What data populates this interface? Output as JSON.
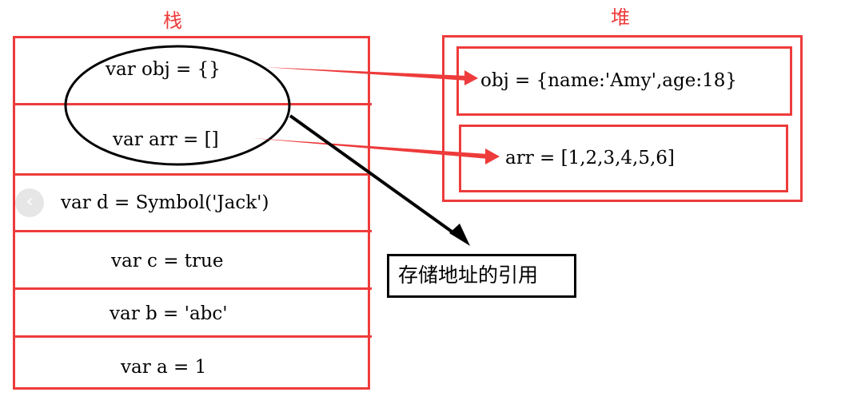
{
  "stack": {
    "title": "栈",
    "cells": [
      "var obj = {}",
      "var arr = []",
      "var d = Symbol('Jack')",
      "var c = true",
      "var b = 'abc'",
      "var a = 1"
    ]
  },
  "heap": {
    "title": "堆",
    "items": [
      "obj = {name:'Amy',age:18}",
      "arr = [1,2,3,4,5,6]"
    ]
  },
  "annotation": {
    "label": "存储地址的引用"
  },
  "back_button_icon": "chevron-left-icon",
  "colors": {
    "stack_heap_border": "#ee3b3b",
    "arrow": "#ee3b3b",
    "annotation": "#000000"
  }
}
